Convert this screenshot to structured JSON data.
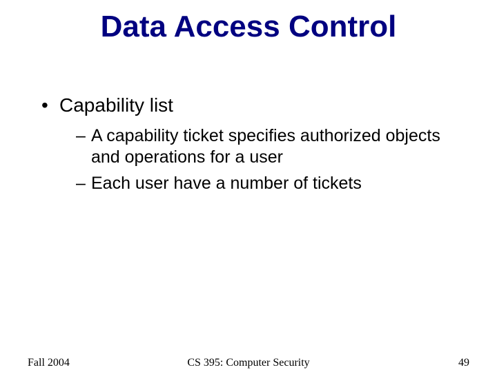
{
  "title": "Data Access Control",
  "bullets": [
    {
      "marker": "•",
      "text": "Capability list",
      "sub": [
        {
          "marker": "–",
          "text": "A capability ticket specifies authorized objects and operations for a user"
        },
        {
          "marker": "–",
          "text": "Each user have a number of tickets"
        }
      ]
    }
  ],
  "footer": {
    "left": "Fall 2004",
    "center": "CS 395: Computer Security",
    "right": "49"
  }
}
